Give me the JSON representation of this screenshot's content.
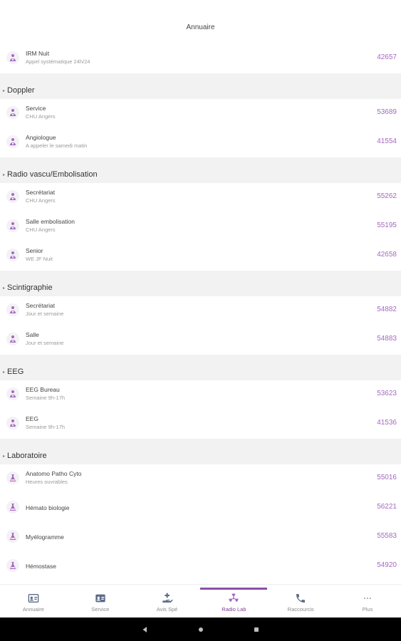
{
  "appbar": {
    "title": "Annuaire"
  },
  "colors": {
    "accent": "#a46ac0",
    "active_nav": "#7b3f94",
    "section_bg": "#f2f2f2"
  },
  "lead_row": {
    "title": "IRM Nuit",
    "subtitle": "Appel systématique 24h/24",
    "phone": "42657",
    "icon": "doctor-icon"
  },
  "sections": [
    {
      "title": "Doppler",
      "rows": [
        {
          "title": "Service",
          "subtitle": "CHU Angers",
          "phone": "53689",
          "icon": "doctor-icon"
        },
        {
          "title": "Angiologue",
          "subtitle": "A appeler le samedi matin",
          "phone": "41554",
          "icon": "doctor-icon"
        }
      ]
    },
    {
      "title": "Radio vascu/Embolisation",
      "rows": [
        {
          "title": "Secrétariat",
          "subtitle": "CHU Angers",
          "phone": "55262",
          "icon": "doctor-icon"
        },
        {
          "title": "Salle embolisation",
          "subtitle": "CHU Angers",
          "phone": "55195",
          "icon": "doctor-icon"
        },
        {
          "title": "Senior",
          "subtitle": "WE JF Nuit",
          "phone": "42658",
          "icon": "doctor-icon"
        }
      ]
    },
    {
      "title": "Scintigraphie",
      "rows": [
        {
          "title": "Secrétariat",
          "subtitle": "Jour et semaine",
          "phone": "54882",
          "icon": "doctor-icon"
        },
        {
          "title": "Salle",
          "subtitle": "Jour et semaine",
          "phone": "54883",
          "icon": "doctor-icon"
        }
      ]
    },
    {
      "title": "EEG",
      "rows": [
        {
          "title": "EEG Bureau",
          "subtitle": "Semaine 9h-17h",
          "phone": "53623",
          "icon": "doctor-icon"
        },
        {
          "title": "EEG",
          "subtitle": "Semaine 9h-17h",
          "phone": "41536",
          "icon": "doctor-icon"
        }
      ]
    },
    {
      "title": "Laboratoire",
      "rows": [
        {
          "title": "Anatomo Patho Cyto",
          "subtitle": "Heures ouvrables",
          "phone": "55016",
          "icon": "flask-icon"
        },
        {
          "title": "Hémato biologie",
          "subtitle": "",
          "phone": "56221",
          "icon": "flask-icon"
        },
        {
          "title": "Myélogramme",
          "subtitle": "",
          "phone": "55583",
          "icon": "flask-icon"
        },
        {
          "title": "Hémostase",
          "subtitle": "",
          "phone": "54920",
          "icon": "flask-icon"
        }
      ]
    }
  ],
  "nav": [
    {
      "label": "Annuaire",
      "icon": "contact-card-icon",
      "active": false
    },
    {
      "label": "Service",
      "icon": "id-card-icon",
      "active": false
    },
    {
      "label": "Avis Spé",
      "icon": "hand-plus-icon",
      "active": false
    },
    {
      "label": "Radio Lab",
      "icon": "radiation-icon",
      "active": true
    },
    {
      "label": "Raccourcis",
      "icon": "phone-icon",
      "active": false
    },
    {
      "label": "Plus",
      "icon": "more-icon",
      "active": false
    }
  ],
  "system_nav": [
    {
      "icon": "back-icon"
    },
    {
      "icon": "home-icon"
    },
    {
      "icon": "recents-icon"
    }
  ]
}
